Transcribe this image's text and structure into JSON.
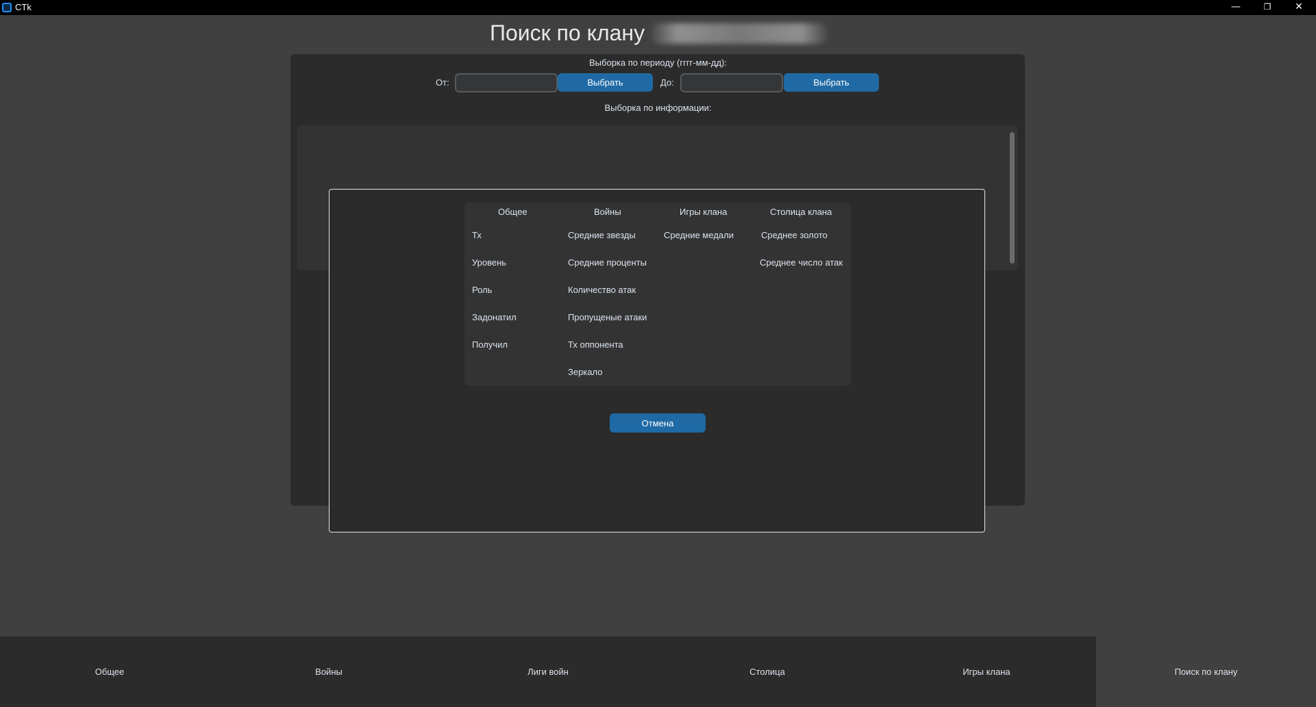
{
  "window": {
    "title": "CTk",
    "min_glyph": "—",
    "max_glyph": "❐",
    "close_glyph": "✕"
  },
  "page": {
    "title": "Поиск по клану"
  },
  "period": {
    "label": "Выборка по периоду (гггг-мм-дд):",
    "from_label": "От:",
    "from_value": "",
    "from_button": "Выбрать",
    "to_label": "До:",
    "to_value": "",
    "to_button": "Выбрать"
  },
  "info": {
    "label": "Выборка по информации:"
  },
  "modal": {
    "columns": [
      {
        "header": "Общее",
        "items": [
          "Тх",
          "Уровень",
          "Роль",
          "Задонатил",
          "Получил"
        ]
      },
      {
        "header": "Войны",
        "items": [
          "Средние звезды",
          "Средние проценты",
          "Количество атак",
          "Пропущеные атаки",
          "Тх оппонента",
          "Зеркало"
        ]
      },
      {
        "header": "Игры клана",
        "items": [
          "Средние медали"
        ]
      },
      {
        "header": "Столица клана",
        "items": [
          "Среднее золото",
          "Среднее число атак"
        ]
      }
    ],
    "cancel_button": "Отмена"
  },
  "nav": {
    "tabs": [
      "Общее",
      "Войны",
      "Лиги войн",
      "Столица",
      "Игры клана",
      "Поиск по клану"
    ],
    "active_index": 5
  },
  "colors": {
    "accent": "#1f6aa5",
    "background": "#404040",
    "frame": "#2b2b2b"
  }
}
